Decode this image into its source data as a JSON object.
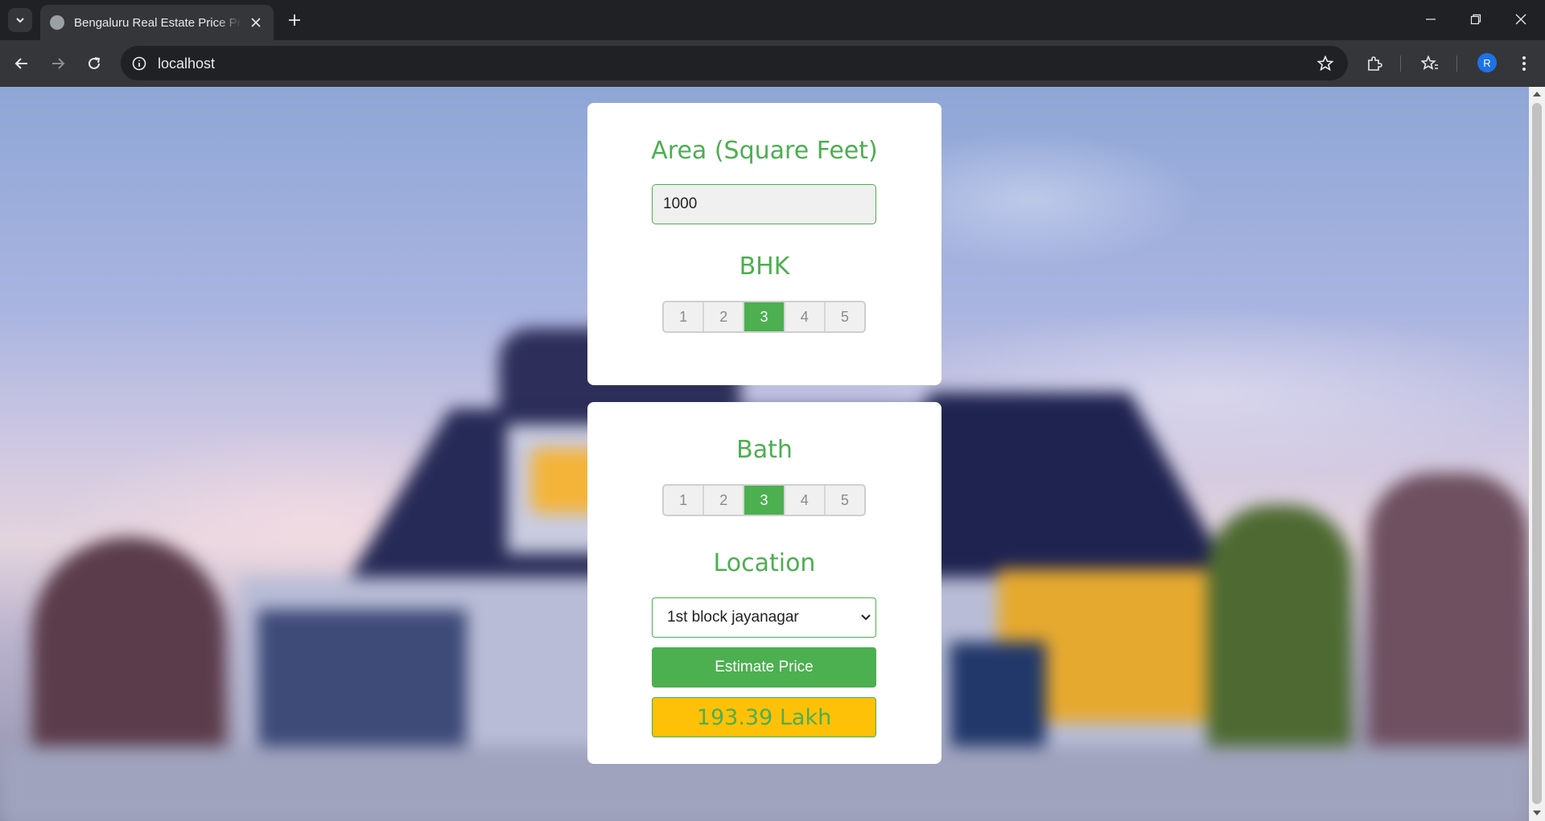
{
  "browser": {
    "tab_title": "Bengaluru Real Estate Price Prediction",
    "url": "localhost",
    "profile_initial": "R"
  },
  "app": {
    "area_label": "Area (Square Feet)",
    "area_value": "1000",
    "bhk_label": "BHK",
    "bhk_options": [
      "1",
      "2",
      "3",
      "4",
      "5"
    ],
    "bhk_selected": "3",
    "bath_label": "Bath",
    "bath_options": [
      "1",
      "2",
      "3",
      "4",
      "5"
    ],
    "bath_selected": "3",
    "location_label": "Location",
    "location_selected": "1st block jayanagar",
    "estimate_button": "Estimate Price",
    "estimated_price": "193.39 Lakh"
  },
  "colors": {
    "accent_green": "#4caf50",
    "result_yellow": "#ffc107",
    "chrome_dark": "#202124",
    "chrome_toolbar": "#35363a"
  },
  "icons": [
    "tab-search-icon",
    "globe-icon",
    "close-icon",
    "plus-icon",
    "minimize-icon",
    "restore-icon",
    "back-arrow-icon",
    "forward-arrow-icon",
    "reload-icon",
    "info-icon",
    "bookmark-star-icon",
    "extensions-icon",
    "bookmarks-icon",
    "more-vert-icon",
    "chevron-down-icon"
  ]
}
